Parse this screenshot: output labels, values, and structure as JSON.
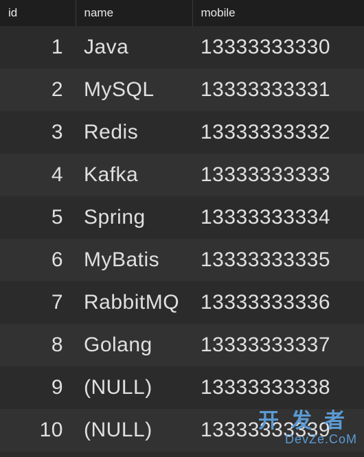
{
  "columns": {
    "id": "id",
    "name": "name",
    "mobile": "mobile"
  },
  "rows": [
    {
      "id": "1",
      "name": "Java",
      "name_null": false,
      "mobile": "13333333330"
    },
    {
      "id": "2",
      "name": "MySQL",
      "name_null": false,
      "mobile": "13333333331"
    },
    {
      "id": "3",
      "name": "Redis",
      "name_null": false,
      "mobile": "13333333332"
    },
    {
      "id": "4",
      "name": "Kafka",
      "name_null": false,
      "mobile": "13333333333"
    },
    {
      "id": "5",
      "name": "Spring",
      "name_null": false,
      "mobile": "13333333334"
    },
    {
      "id": "6",
      "name": "MyBatis",
      "name_null": false,
      "mobile": "13333333335"
    },
    {
      "id": "7",
      "name": "RabbitMQ",
      "name_null": false,
      "mobile": "13333333336"
    },
    {
      "id": "8",
      "name": "Golang",
      "name_null": false,
      "mobile": "13333333337"
    },
    {
      "id": "9",
      "name": "(NULL)",
      "name_null": true,
      "mobile": "13333333338"
    },
    {
      "id": "10",
      "name": "(NULL)",
      "name_null": true,
      "mobile": "13333333339"
    }
  ],
  "watermark": {
    "cn": "开发者",
    "en": "DevZe.CoM"
  }
}
